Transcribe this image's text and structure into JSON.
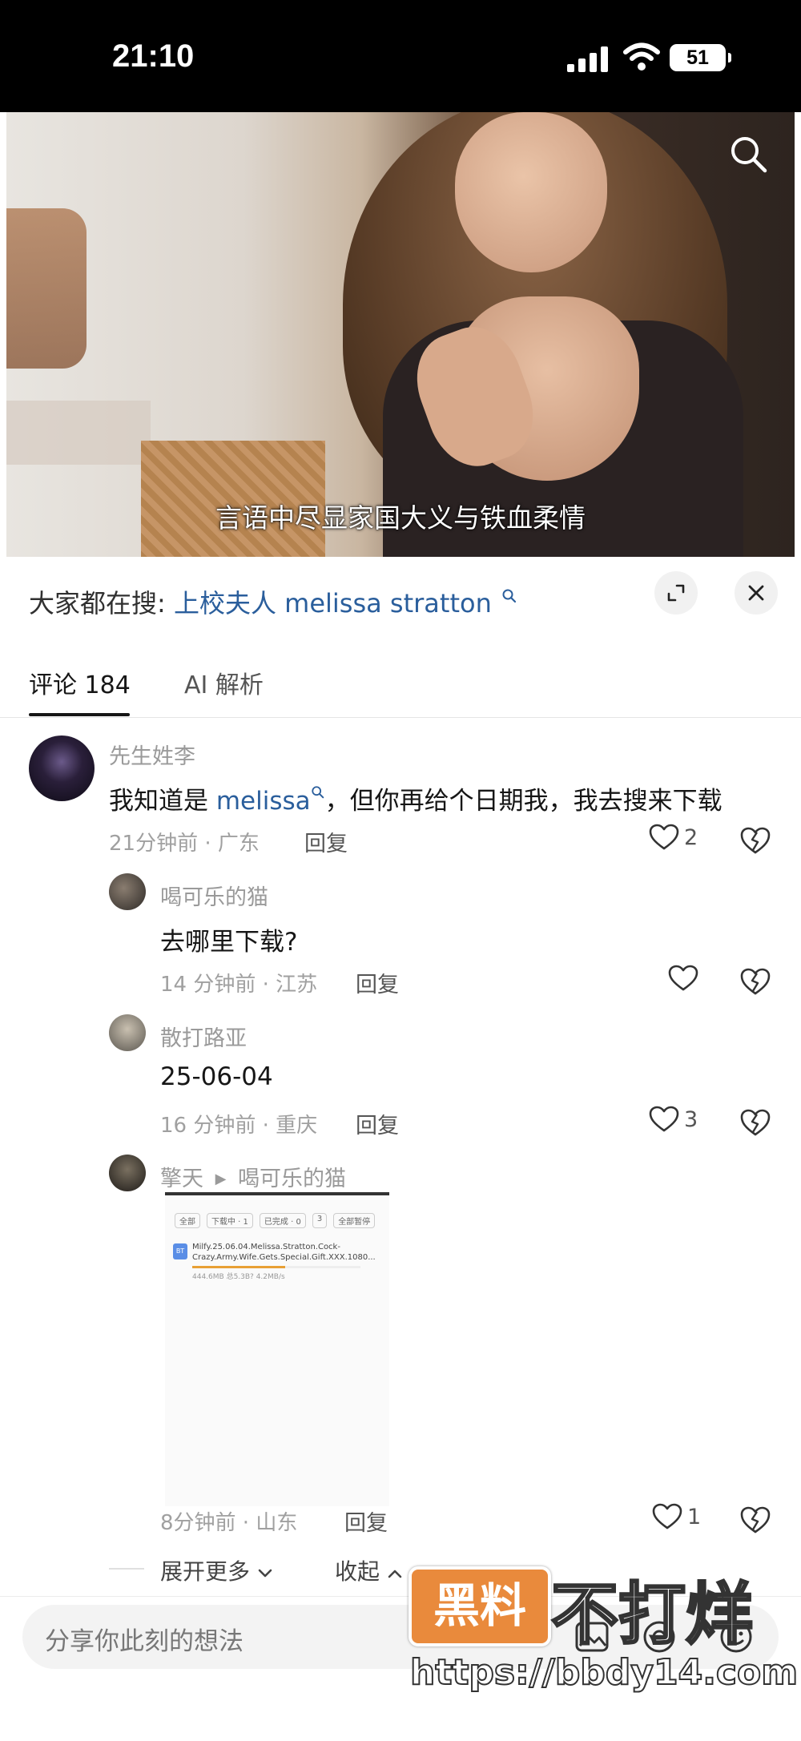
{
  "status_bar": {
    "time": "21:10",
    "battery": "51"
  },
  "video": {
    "subtitle": "言语中尽显家国大义与铁血柔情"
  },
  "trending": {
    "prefix": "大家都在搜:",
    "keyword": "上校夫人 melissa stratton"
  },
  "tabs": [
    {
      "label": "评论 184",
      "active": true
    },
    {
      "label": "AI 解析",
      "active": false
    }
  ],
  "comments": [
    {
      "user": "先生姓李",
      "text_prefix": "我知道是 ",
      "keyword": "melissa",
      "text_suffix": "，但你再给个日期我，我去搜来下载",
      "meta": "21分钟前 · 广东",
      "reply": "回复",
      "likes": "2"
    }
  ],
  "replies": [
    {
      "user": "喝可乐的猫",
      "text": "去哪里下载?",
      "meta": "14 分钟前 · 江苏",
      "reply": "回复",
      "likes": ""
    },
    {
      "user": "散打路亚",
      "text": "25-06-04",
      "meta": "16 分钟前 · 重庆",
      "reply": "回复",
      "likes": "3"
    },
    {
      "user": "擎天",
      "reply_to": "喝可乐的猫",
      "meta": "8分钟前 · 山东",
      "reply": "回复",
      "likes": "1",
      "image": {
        "tabs": [
          "全部",
          "下载中 · 1",
          "已完成 · 0",
          "3",
          "全部暂停"
        ],
        "icon": "BT",
        "file_name": "Milfy.25.06.04.Melissa.Stratton.Cock-Crazy.Army.Wife.Gets.Special.Gift.XXX.1080...",
        "file_meta": "444.6MB  总5.3B?   4.2MB/s",
        "progress": 0.55
      }
    }
  ],
  "thread": {
    "expand_more": "展开更多",
    "collapse": "收起"
  },
  "input": {
    "placeholder": "分享你此刻的想法"
  },
  "watermark": {
    "badge": "黑料",
    "text": "不打烊",
    "url": "https://bbdy14.com"
  },
  "colors": {
    "keyword": "#2a5e9c",
    "watermark": "#e98a3c"
  }
}
